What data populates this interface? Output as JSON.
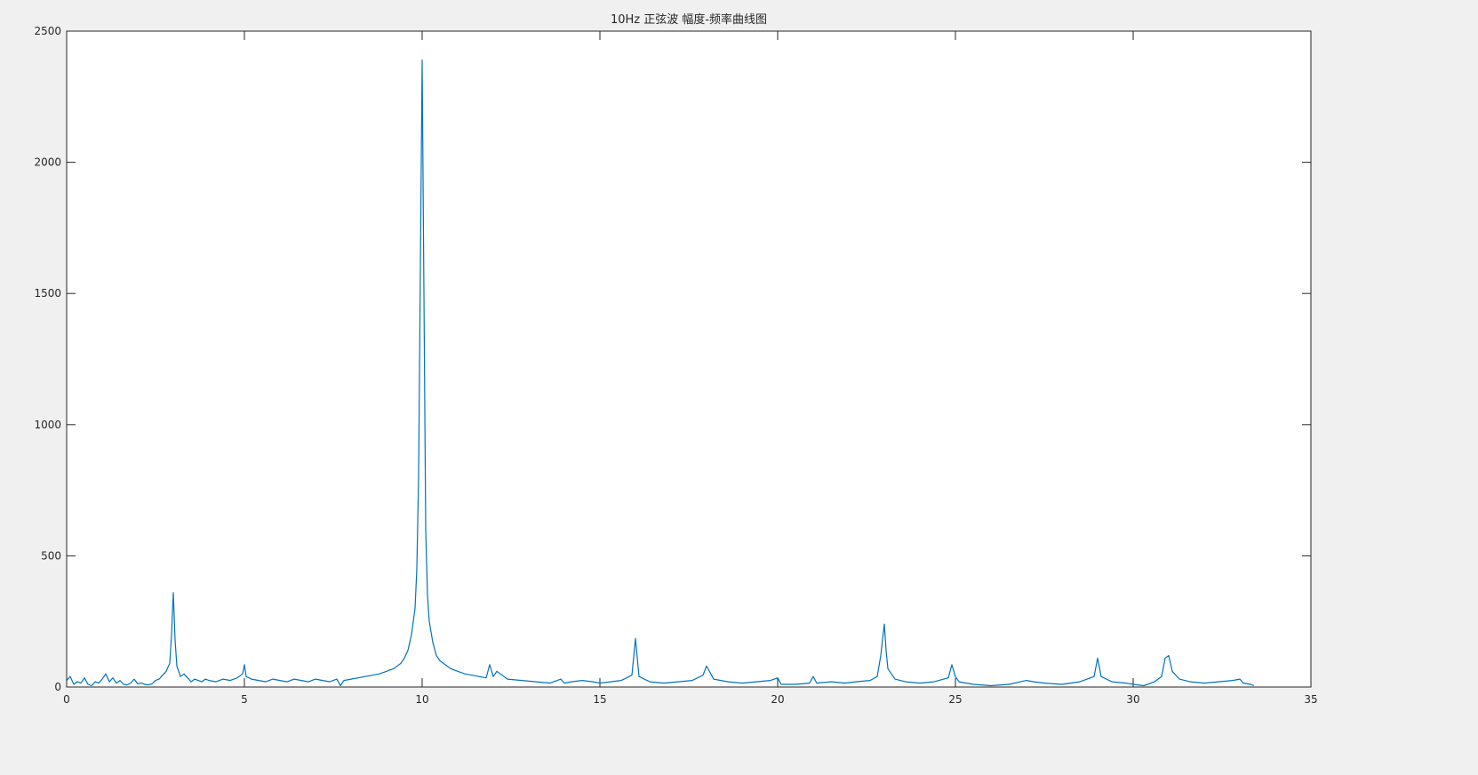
{
  "window": {
    "background": "#f0f0f0"
  },
  "chart_data": {
    "type": "line",
    "title": "10Hz 正弦波 幅度-频率曲线图",
    "xlabel": "",
    "ylabel": "",
    "xlim": [
      0,
      35
    ],
    "ylim": [
      0,
      2500
    ],
    "xticks": [
      0,
      5,
      10,
      15,
      20,
      25,
      30,
      35
    ],
    "yticks": [
      0,
      500,
      1000,
      1500,
      2000,
      2500
    ],
    "grid": false,
    "legend": "none",
    "line_color": "#0072bd",
    "series": [
      {
        "x": [
          0,
          0.1,
          0.2,
          0.3,
          0.4,
          0.5,
          0.6,
          0.7,
          0.8,
          0.9,
          1.0,
          1.1,
          1.2,
          1.3,
          1.4,
          1.5,
          1.6,
          1.7,
          1.8,
          1.9,
          2.0,
          2.1,
          2.2,
          2.3,
          2.4,
          2.5,
          2.6,
          2.7,
          2.8,
          2.9,
          2.95,
          3.0,
          3.05,
          3.1,
          3.2,
          3.3,
          3.4,
          3.5,
          3.6,
          3.7,
          3.8,
          3.9,
          4.0,
          4.2,
          4.4,
          4.6,
          4.8,
          4.95,
          5.0,
          5.05,
          5.2,
          5.4,
          5.6,
          5.8,
          6.0,
          6.2,
          6.4,
          6.6,
          6.8,
          7.0,
          7.2,
          7.4,
          7.6,
          7.7,
          7.8,
          8.0,
          8.2,
          8.4,
          8.6,
          8.8,
          9.0,
          9.2,
          9.4,
          9.5,
          9.6,
          9.7,
          9.8,
          9.85,
          9.9,
          9.95,
          10.0,
          10.05,
          10.1,
          10.15,
          10.2,
          10.3,
          10.4,
          10.5,
          10.6,
          10.7,
          10.8,
          11.0,
          11.2,
          11.4,
          11.6,
          11.8,
          11.9,
          12.0,
          12.1,
          12.4,
          12.8,
          13.2,
          13.6,
          13.9,
          14.0,
          14.2,
          14.5,
          14.8,
          15.0,
          15.3,
          15.6,
          15.9,
          16.0,
          16.1,
          16.4,
          16.8,
          17.2,
          17.6,
          17.9,
          18.0,
          18.2,
          18.6,
          19.0,
          19.4,
          19.8,
          20.0,
          20.1,
          20.5,
          20.9,
          21.0,
          21.1,
          21.5,
          21.9,
          22.2,
          22.6,
          22.8,
          22.9,
          23.0,
          23.05,
          23.1,
          23.3,
          23.6,
          24.0,
          24.4,
          24.8,
          24.9,
          25.0,
          25.1,
          25.5,
          26.0,
          26.5,
          27.0,
          27.2,
          27.5,
          28.0,
          28.5,
          28.9,
          29.0,
          29.1,
          29.4,
          29.8,
          30.0,
          30.3,
          30.6,
          30.8,
          30.9,
          31.0,
          31.1,
          31.3,
          31.6,
          32.0,
          32.4,
          32.8,
          33.0,
          33.1,
          33.3,
          33.4
        ],
        "y": [
          25,
          40,
          10,
          20,
          15,
          35,
          10,
          5,
          20,
          15,
          30,
          50,
          20,
          35,
          15,
          25,
          10,
          8,
          15,
          30,
          12,
          15,
          10,
          8,
          12,
          25,
          30,
          45,
          60,
          90,
          200,
          360,
          180,
          80,
          40,
          50,
          35,
          20,
          30,
          25,
          20,
          30,
          25,
          20,
          30,
          25,
          35,
          50,
          85,
          40,
          30,
          25,
          20,
          30,
          25,
          20,
          30,
          25,
          20,
          30,
          25,
          20,
          30,
          5,
          25,
          30,
          35,
          40,
          45,
          50,
          60,
          70,
          90,
          110,
          140,
          200,
          300,
          450,
          800,
          1600,
          2390,
          1500,
          600,
          350,
          250,
          170,
          120,
          100,
          90,
          80,
          70,
          60,
          50,
          45,
          40,
          35,
          85,
          40,
          60,
          30,
          25,
          20,
          15,
          30,
          15,
          20,
          25,
          20,
          15,
          20,
          25,
          45,
          185,
          40,
          20,
          15,
          20,
          25,
          45,
          80,
          30,
          20,
          15,
          20,
          25,
          35,
          10,
          10,
          15,
          40,
          15,
          20,
          15,
          20,
          25,
          40,
          120,
          240,
          140,
          70,
          30,
          20,
          15,
          20,
          35,
          85,
          40,
          20,
          10,
          5,
          10,
          25,
          20,
          15,
          10,
          20,
          40,
          110,
          40,
          20,
          15,
          10,
          5,
          20,
          40,
          110,
          120,
          60,
          30,
          20,
          15,
          20,
          25,
          30,
          15,
          10,
          5
        ]
      }
    ]
  }
}
